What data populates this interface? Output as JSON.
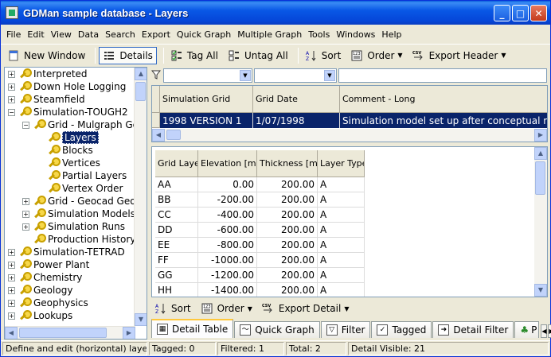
{
  "window": {
    "title": "GDMan sample database - Layers",
    "buttons": {
      "minimize": "_",
      "maximize": "□",
      "close": "✕"
    }
  },
  "menu": [
    "File",
    "Edit",
    "View",
    "Data",
    "Search",
    "Export",
    "Quick Graph",
    "Multiple Graph",
    "Tools",
    "Windows",
    "Help"
  ],
  "toolbar": {
    "new_window": "New Window",
    "details": "Details",
    "tag_all": "Tag All",
    "untag_all": "Untag All",
    "sort": "Sort",
    "order": "Order",
    "export_header": "Export Header"
  },
  "tree": {
    "items": [
      {
        "label": "Interpreted",
        "level": 0,
        "expander": "+"
      },
      {
        "label": "Down Hole Logging",
        "level": 0,
        "expander": "+"
      },
      {
        "label": "Steamfield",
        "level": 0,
        "expander": "+"
      },
      {
        "label": "Simulation-TOUGH2",
        "level": 0,
        "expander": "−"
      },
      {
        "label": "Grid - Mulgraph Ge",
        "level": 1,
        "expander": "−"
      },
      {
        "label": "Layers",
        "level": 2,
        "expander": "",
        "selected": true
      },
      {
        "label": "Blocks",
        "level": 2,
        "expander": ""
      },
      {
        "label": "Vertices",
        "level": 2,
        "expander": ""
      },
      {
        "label": "Partial Layers",
        "level": 2,
        "expander": ""
      },
      {
        "label": "Vertex Order",
        "level": 2,
        "expander": ""
      },
      {
        "label": "Grid - Geocad Geor",
        "level": 1,
        "expander": "+"
      },
      {
        "label": "Simulation Models",
        "level": 1,
        "expander": "+"
      },
      {
        "label": "Simulation Runs",
        "level": 1,
        "expander": "+"
      },
      {
        "label": "Production History",
        "level": 1,
        "expander": ""
      },
      {
        "label": "Simulation-TETRAD",
        "level": 0,
        "expander": "+"
      },
      {
        "label": "Power Plant",
        "level": 0,
        "expander": "+"
      },
      {
        "label": "Chemistry",
        "level": 0,
        "expander": "+"
      },
      {
        "label": "Geology",
        "level": 0,
        "expander": "+"
      },
      {
        "label": "Geophysics",
        "level": 0,
        "expander": "+"
      },
      {
        "label": "Lookups",
        "level": 0,
        "expander": "+"
      }
    ]
  },
  "master": {
    "columns": [
      "Simulation Grid",
      "Grid Date",
      "Comment - Long"
    ],
    "rows": [
      [
        "1998 VERSION 1",
        "1/07/1998",
        "Simulation model set up after conceptual mode"
      ]
    ]
  },
  "detail": {
    "columns": [
      "Grid Layer",
      "Elevation [m]",
      "Thickness [m]",
      "Layer Type"
    ],
    "rows": [
      [
        "AA",
        "0.00",
        "200.00",
        "A"
      ],
      [
        "BB",
        "-200.00",
        "200.00",
        "A"
      ],
      [
        "CC",
        "-400.00",
        "200.00",
        "A"
      ],
      [
        "DD",
        "-600.00",
        "200.00",
        "A"
      ],
      [
        "EE",
        "-800.00",
        "200.00",
        "A"
      ],
      [
        "FF",
        "-1000.00",
        "200.00",
        "A"
      ],
      [
        "GG",
        "-1200.00",
        "200.00",
        "A"
      ],
      [
        "HH",
        "-1400.00",
        "200.00",
        "A"
      ]
    ]
  },
  "detail_toolbar": {
    "sort": "Sort",
    "order": "Order",
    "export_detail": "Export Detail"
  },
  "tabs": [
    {
      "label": "Detail Table",
      "active": true
    },
    {
      "label": "Quick Graph",
      "active": false
    },
    {
      "label": "Filter",
      "active": false
    },
    {
      "label": "Tagged",
      "active": false
    },
    {
      "label": "Detail Filter",
      "active": false
    },
    {
      "label": "P",
      "active": false
    }
  ],
  "status": {
    "hint": "Define and edit (horizontal) layers of",
    "tagged": "Tagged: 0",
    "filtered": "Filtered: 1",
    "total": "Total: 2",
    "detail_visible": "Detail Visible: 21"
  }
}
